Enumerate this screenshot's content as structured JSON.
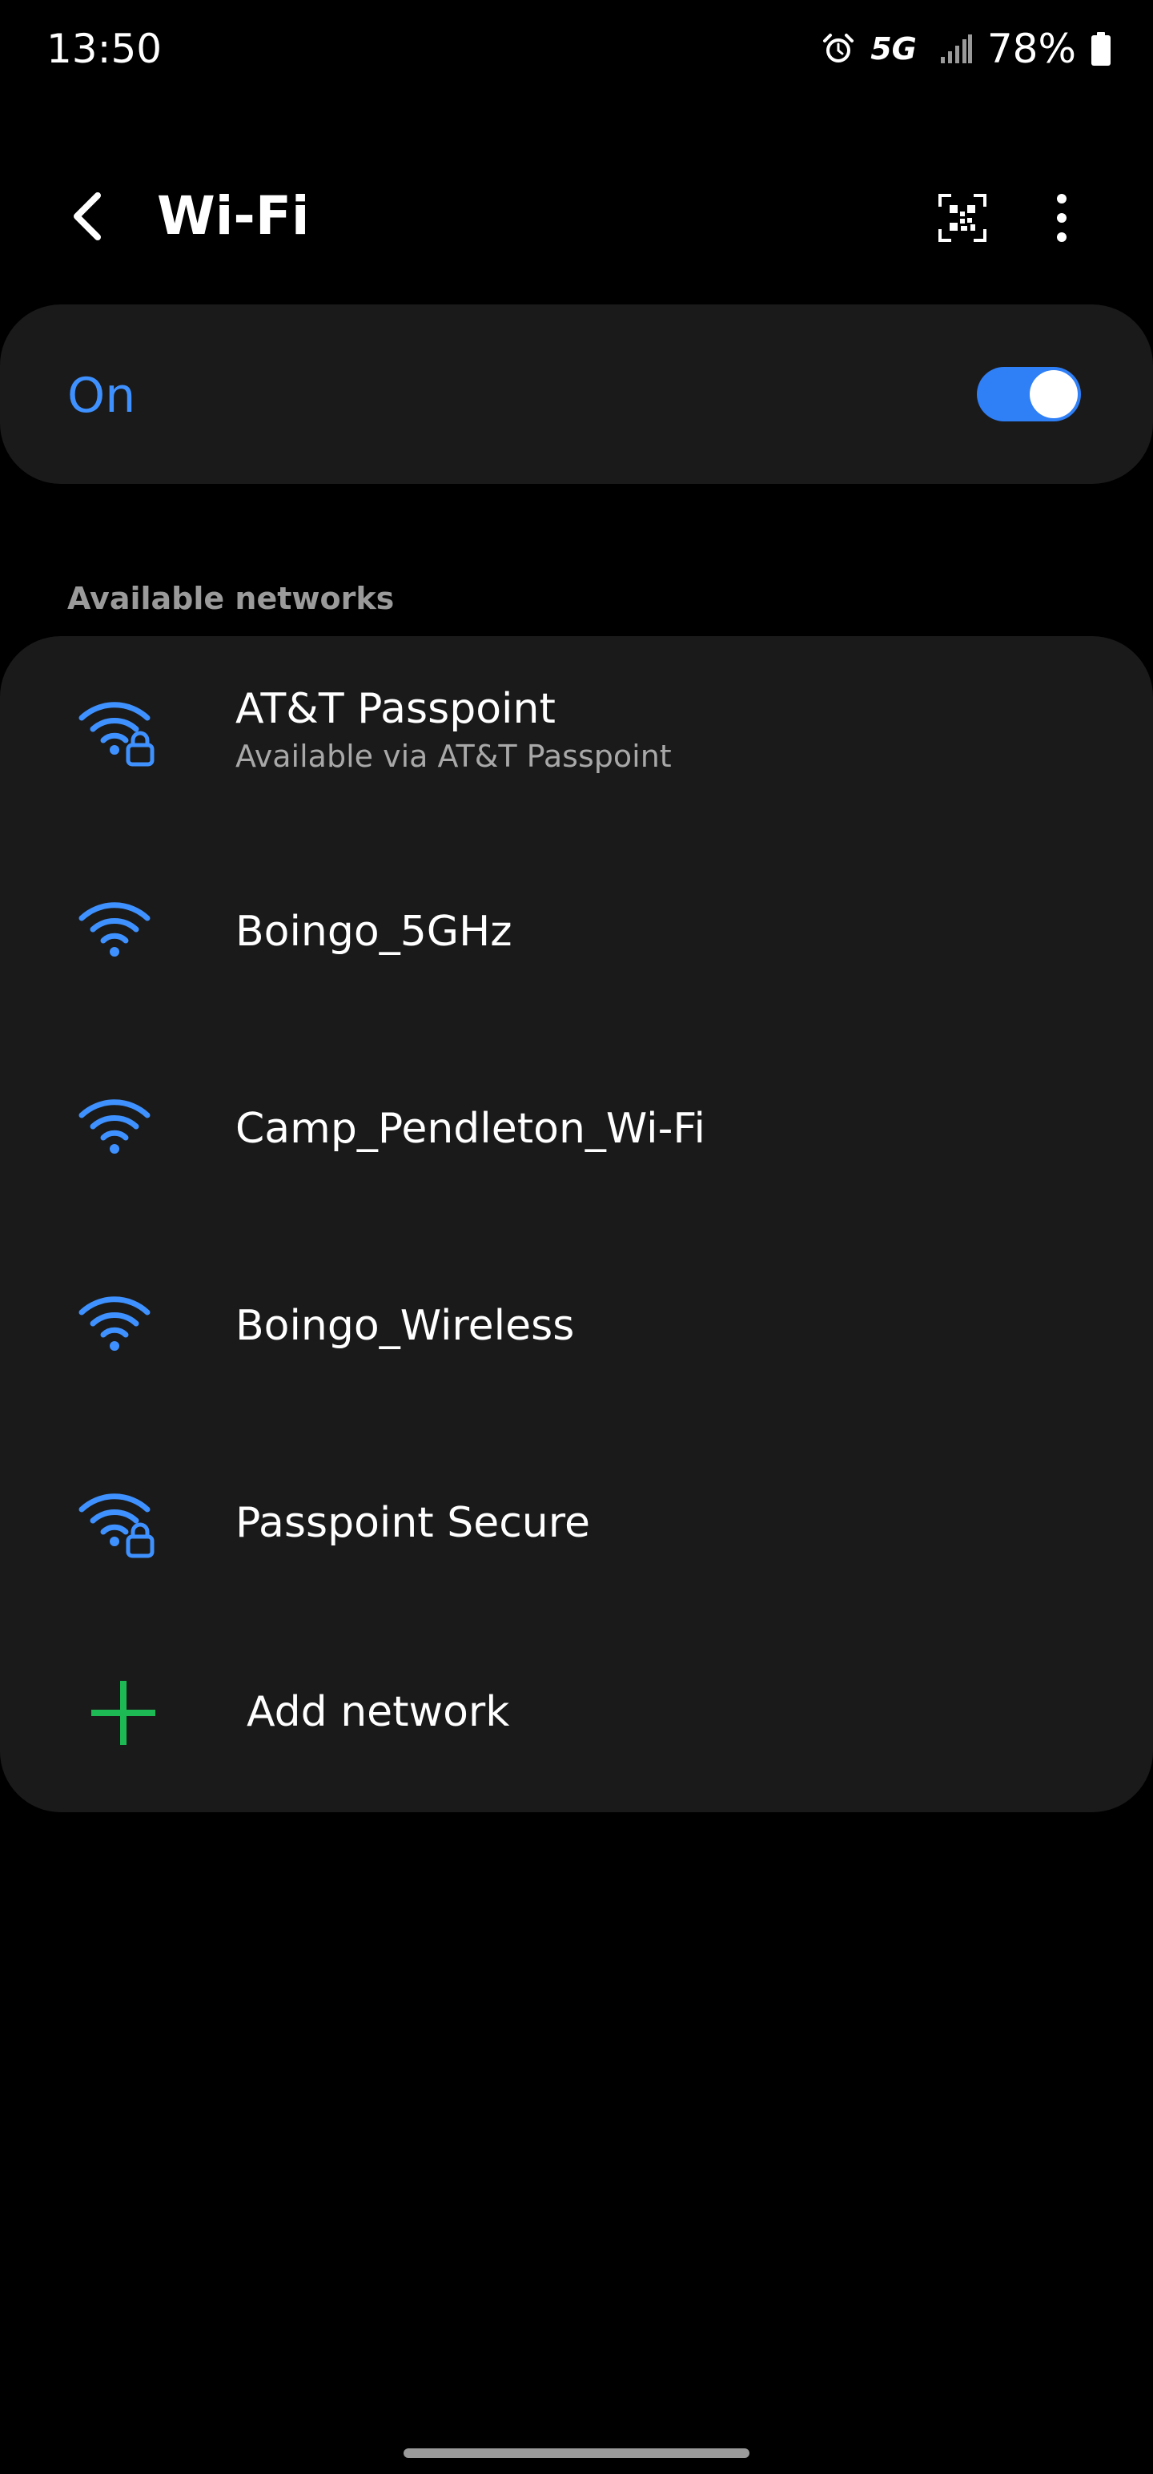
{
  "status_bar": {
    "time": "13:50",
    "network_type": "5G",
    "battery_percent": "78%",
    "icons": [
      "alarm-icon",
      "signal-icon",
      "battery-icon"
    ]
  },
  "header": {
    "title": "Wi-Fi",
    "back_icon": "back-arrow-icon",
    "qr_icon": "qr-code-scan-icon",
    "more_icon": "more-options-icon"
  },
  "master_toggle": {
    "label": "On",
    "checked": true
  },
  "available_networks": {
    "section_label": "Available networks",
    "items": [
      {
        "name": "AT&T Passpoint",
        "subtitle": "Available via AT&T Passpoint",
        "secured": true,
        "icon": "wifi-lock-icon"
      },
      {
        "name": "Boingo_5GHz",
        "subtitle": "",
        "secured": false,
        "icon": "wifi-icon"
      },
      {
        "name": "Camp_Pendleton_Wi-Fi",
        "subtitle": "",
        "secured": false,
        "icon": "wifi-icon"
      },
      {
        "name": "Boingo_Wireless",
        "subtitle": "",
        "secured": false,
        "icon": "wifi-icon"
      },
      {
        "name": "Passpoint Secure",
        "subtitle": "",
        "secured": true,
        "icon": "wifi-lock-icon"
      }
    ],
    "add_network": {
      "label": "Add network",
      "icon": "plus-icon"
    }
  },
  "colors": {
    "accent_blue": "#3e91ff",
    "switch_blue": "#2f7ff7",
    "add_green": "#1db954",
    "card_background": "#1a1a1a",
    "page_background": "#000000"
  }
}
